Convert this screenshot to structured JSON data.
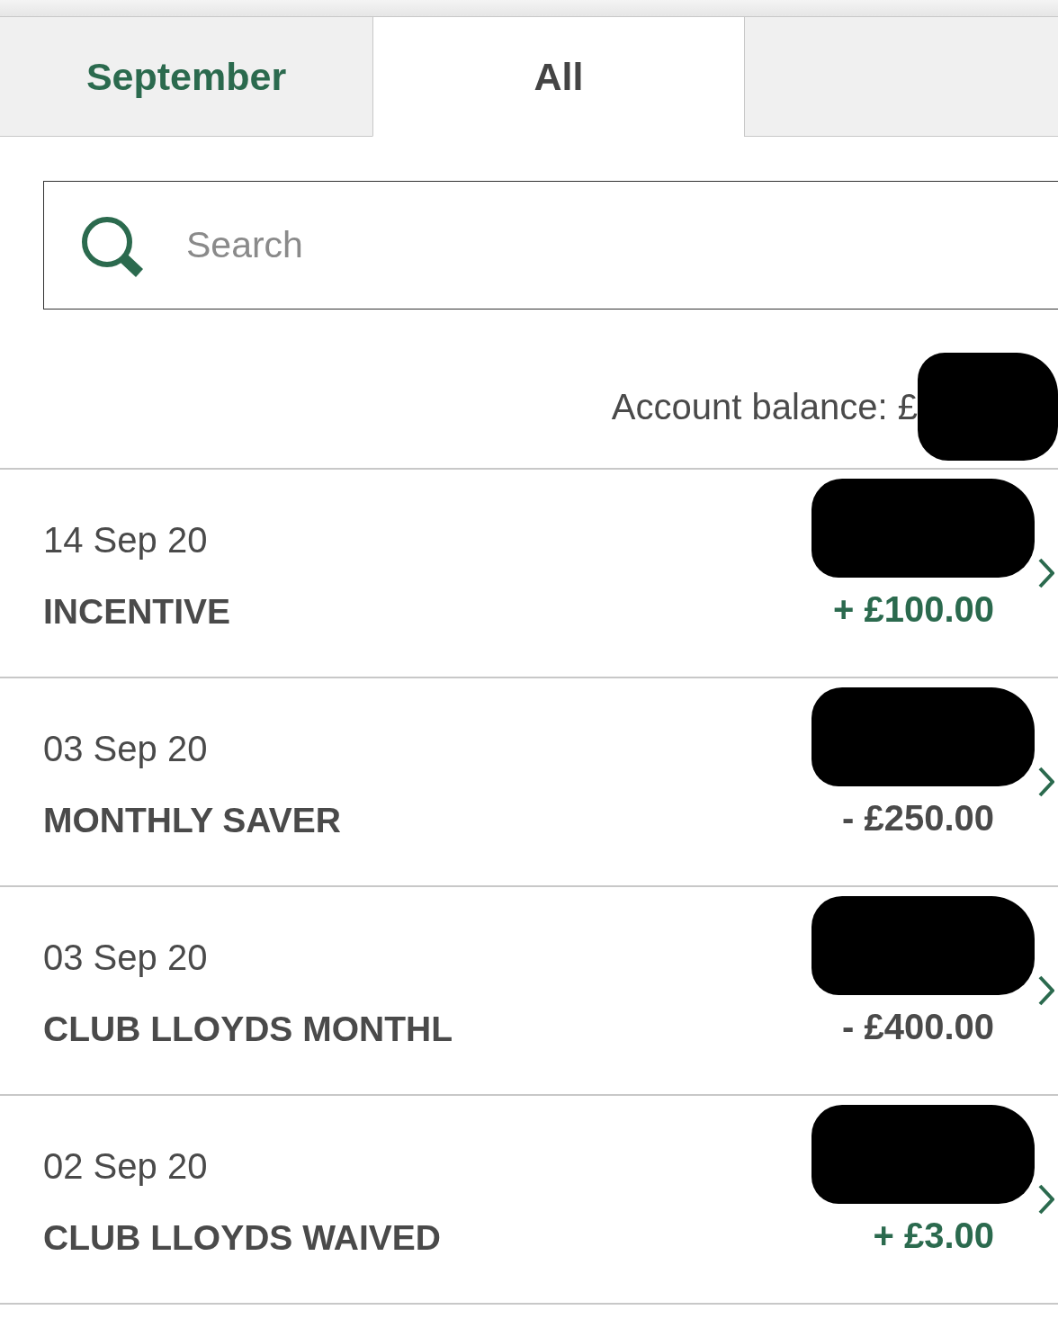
{
  "tabs": [
    {
      "label": "September",
      "selected": false
    },
    {
      "label": "All",
      "selected": true
    },
    {
      "selected": false
    }
  ],
  "search": {
    "placeholder": "Search"
  },
  "account_balance": {
    "label": "Account balance: £",
    "redacted": true
  },
  "transactions": [
    {
      "date": "14 Sep 20",
      "description": "INCENTIVE",
      "amount": "+ £100.00",
      "kind": "credit",
      "redacted": true
    },
    {
      "date": "03 Sep 20",
      "description": "MONTHLY SAVER",
      "amount": "- £250.00",
      "kind": "debit",
      "redacted": true
    },
    {
      "date": "03 Sep 20",
      "description": "CLUB LLOYDS MONTHL",
      "amount": "- £400.00",
      "kind": "debit",
      "redacted": true
    },
    {
      "date": "02 Sep 20",
      "description": "CLUB LLOYDS WAIVED",
      "amount": "+ £3.00",
      "kind": "credit",
      "redacted": true
    }
  ]
}
